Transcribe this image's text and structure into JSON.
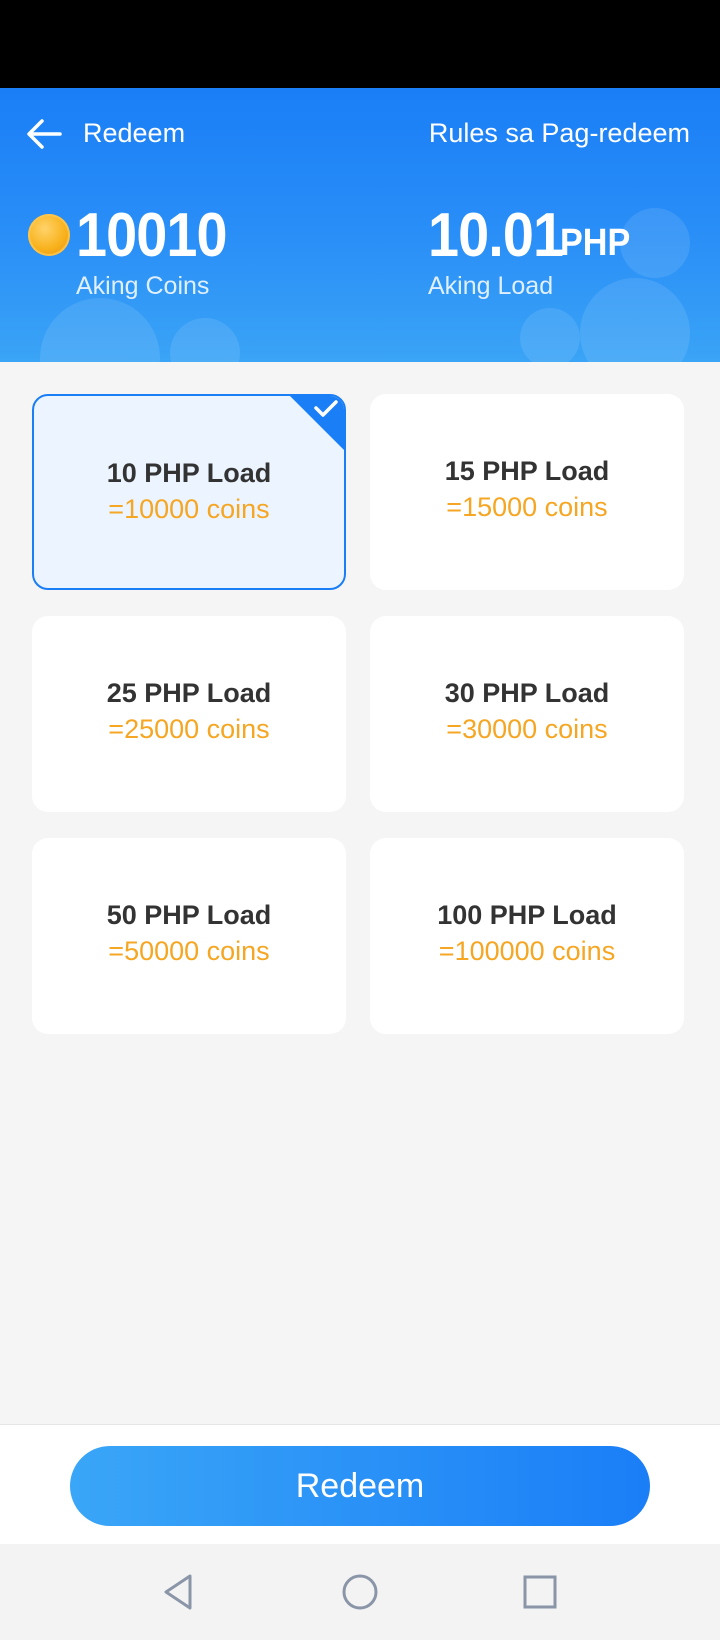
{
  "header": {
    "title": "Redeem",
    "rules_link": "Rules sa Pag-redeem",
    "coins": {
      "value": "10010",
      "label": "Aking Coins"
    },
    "load": {
      "value": "10.01",
      "unit": "PHP",
      "label": "Aking Load"
    }
  },
  "options": [
    {
      "title": "10 PHP Load",
      "price": "=10000 coins",
      "selected": true
    },
    {
      "title": "15 PHP Load",
      "price": "=15000 coins",
      "selected": false
    },
    {
      "title": "25 PHP Load",
      "price": "=25000 coins",
      "selected": false
    },
    {
      "title": "30 PHP Load",
      "price": "=30000 coins",
      "selected": false
    },
    {
      "title": "50 PHP Load",
      "price": "=50000 coins",
      "selected": false
    },
    {
      "title": "100 PHP Load",
      "price": "=100000 coins",
      "selected": false
    }
  ],
  "footer": {
    "redeem_label": "Redeem"
  },
  "icons": {
    "back": "arrow-left-icon",
    "coin": "coin-icon",
    "check": "check-icon",
    "nav_back": "triangle-back-icon",
    "nav_home": "circle-home-icon",
    "nav_recents": "square-recents-icon"
  },
  "colors": {
    "primary": "#1a7ef7",
    "accent_price": "#f5a623",
    "selected_bg": "#ecf4ff"
  }
}
